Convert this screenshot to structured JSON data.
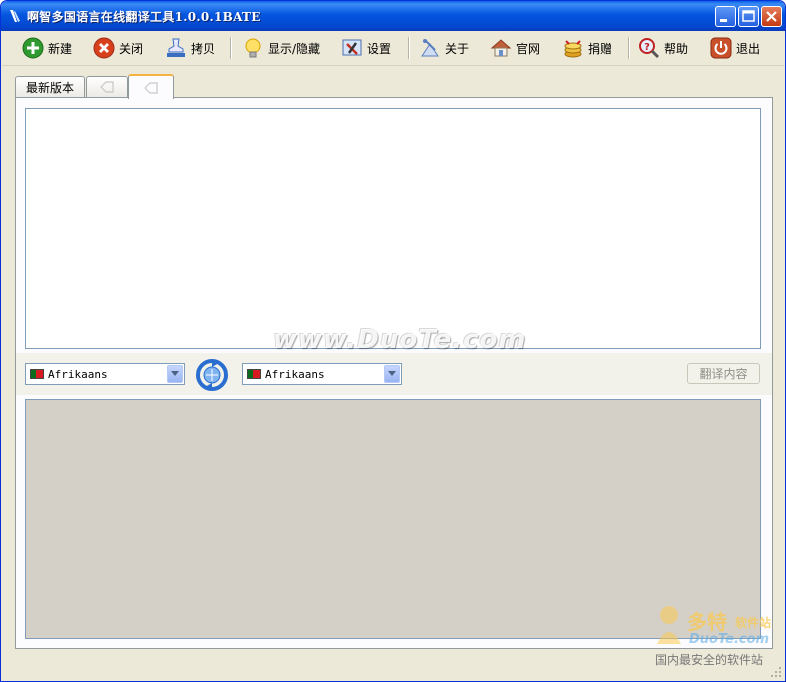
{
  "window": {
    "title": "啊智多国语言在线翻译工具1.0.0.1BATE",
    "controls": [
      "minimize",
      "maximize",
      "close"
    ]
  },
  "toolbar": {
    "items": [
      {
        "label": "新建",
        "icon": "plus-circle-icon",
        "color": "#2f9a2f"
      },
      {
        "label": "关闭",
        "icon": "x-circle-icon",
        "color": "#d8401c"
      },
      {
        "label": "拷贝",
        "icon": "copy-stamp-icon",
        "color": "#3a6ec2"
      },
      {
        "label": "显示/隐藏",
        "icon": "lightbulb-icon",
        "color": "#f4c430"
      },
      {
        "label": "设置",
        "icon": "settings-tools-icon",
        "color": "#4a6fb0"
      },
      {
        "label": "关于",
        "icon": "satellite-icon",
        "color": "#5a7fc0"
      },
      {
        "label": "官网",
        "icon": "house-icon",
        "color": "#c0603a"
      },
      {
        "label": "捐赠",
        "icon": "coins-icon",
        "color": "#e0a020"
      },
      {
        "label": "帮助",
        "icon": "help-magnifier-icon",
        "color": "#c02020"
      },
      {
        "label": "退出",
        "icon": "power-icon",
        "color": "#c03020"
      }
    ]
  },
  "tabs": [
    {
      "label": "最新版本",
      "active": false
    },
    {
      "label": "",
      "icon": "tag-icon",
      "active": false
    },
    {
      "label": "",
      "icon": "tag-icon",
      "active": true
    }
  ],
  "source_text": {
    "value": ""
  },
  "language_bar": {
    "source_language": "Afrikaans",
    "target_language": "Afrikaans",
    "swap_icon": "swap-arrows-icon",
    "translate_label": "翻译内容"
  },
  "result_text": {
    "value": ""
  },
  "watermarks": {
    "center": "www.DuoTe.com",
    "corner_brand": "多特",
    "corner_brand_suffix": "软件站",
    "corner_url": "DuoTe.com",
    "corner_slogan": "国内最安全的软件站"
  }
}
